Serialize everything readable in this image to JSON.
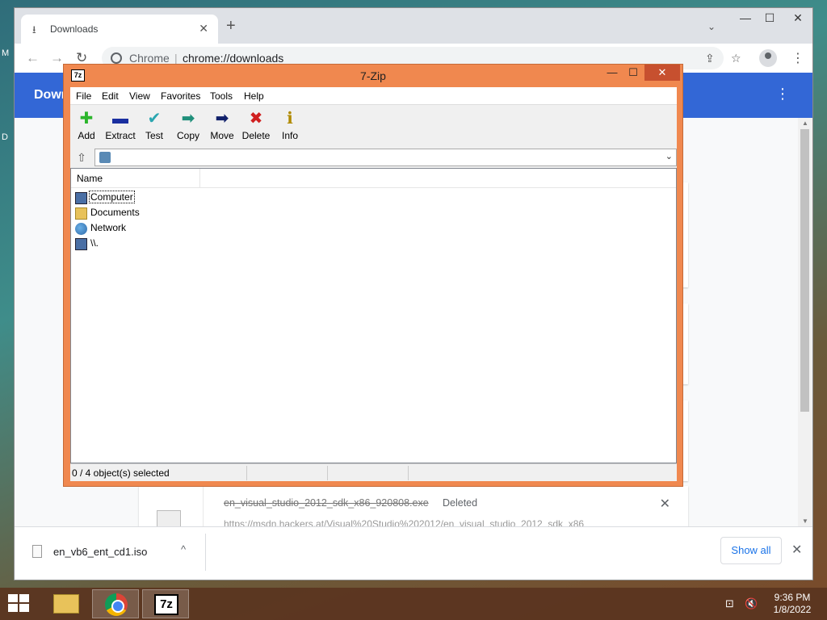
{
  "desktop": {
    "left_letters": [
      "M",
      "D"
    ]
  },
  "chrome": {
    "tab_title": "Downloads",
    "tab_close": "✕",
    "new_tab": "+",
    "tab_search": "⌄",
    "win_min": "—",
    "win_max": "☐",
    "win_close": "✕",
    "back": "←",
    "forward": "→",
    "reload": "↻",
    "site_name": "Chrome",
    "site_sep": "|",
    "url": "chrome://downloads",
    "share": "⇪",
    "bookmark": "☆",
    "menu": "⋮",
    "header_title": "Downloads",
    "header_menu": "⋮",
    "deleted_item": {
      "filename": "en_visual_studio_2012_sdk_x86_920808.exe",
      "status": "Deleted",
      "url": "https://msdn.hackers.at/Visual%20Studio%202012/en_visual_studio_2012_sdk_x86",
      "close": "✕"
    },
    "shelf": {
      "filename": "en_vb6_ent_cd1.iso",
      "caret": "^",
      "show_all": "Show all",
      "close": "✕"
    },
    "scroll_up": "▲",
    "scroll_down": "▼"
  },
  "zip": {
    "app_icon": "7z",
    "title": "7-Zip",
    "min": "—",
    "max": "☐",
    "close": "✕",
    "menu": [
      "File",
      "Edit",
      "View",
      "Favorites",
      "Tools",
      "Help"
    ],
    "tools": [
      {
        "label": "Add",
        "glyph": "✚",
        "color": "#2bb52b"
      },
      {
        "label": "Extract",
        "glyph": "▬",
        "color": "#1a2fa0"
      },
      {
        "label": "Test",
        "glyph": "✔",
        "color": "#2aa6b0"
      },
      {
        "label": "Copy",
        "glyph": "➡",
        "color": "#1f8f7a"
      },
      {
        "label": "Move",
        "glyph": "➡",
        "color": "#10206a"
      },
      {
        "label": "Delete",
        "glyph": "✖",
        "color": "#d02020"
      },
      {
        "label": "Info",
        "glyph": "ℹ",
        "color": "#b08a00"
      }
    ],
    "up_glyph": "⇧",
    "addr_drop": "⌄",
    "column_name": "Name",
    "items": [
      {
        "label": "Computer",
        "icon": "computer"
      },
      {
        "label": "Documents",
        "icon": "folder"
      },
      {
        "label": "Network",
        "icon": "network"
      },
      {
        "label": "\\\\.",
        "icon": "computer"
      }
    ],
    "status": "0 / 4 object(s) selected"
  },
  "taskbar": {
    "zip_label": "7z",
    "tray_network": "⊡",
    "tray_volume": "🔇",
    "time": "9:36 PM",
    "date": "1/8/2022"
  }
}
